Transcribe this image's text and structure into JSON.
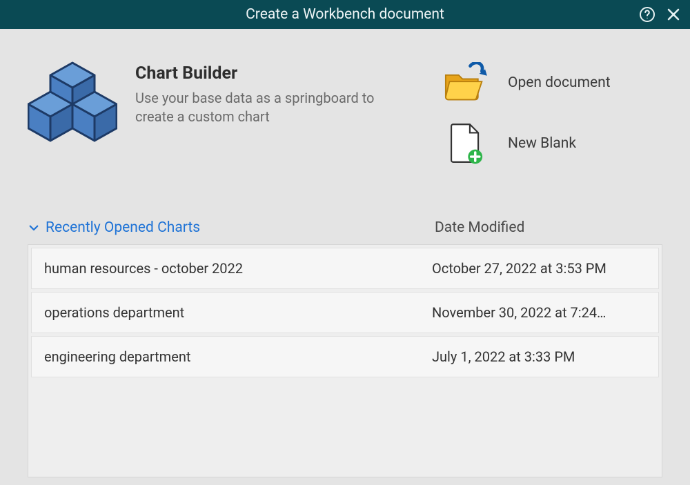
{
  "titlebar": {
    "title": "Create a Workbench document"
  },
  "hero": {
    "title": "Chart Builder",
    "description": "Use your base data as a springboard to create a custom chart"
  },
  "actions": {
    "open": "Open document",
    "blank": "New Blank"
  },
  "recent": {
    "heading": "Recently Opened Charts",
    "date_heading": "Date Modified",
    "items": [
      {
        "name": "human resources - october 2022",
        "date": "October 27, 2022 at 3:53 PM"
      },
      {
        "name": "operations department",
        "date": "November 30, 2022 at 7:24…"
      },
      {
        "name": "engineering department",
        "date": "July 1, 2022 at 3:33 PM"
      }
    ]
  }
}
